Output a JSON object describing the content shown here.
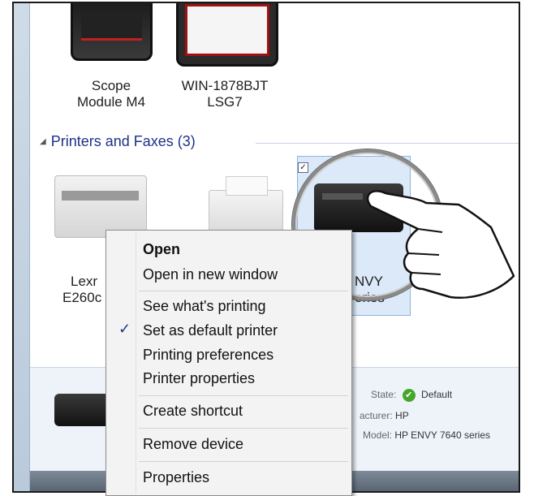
{
  "devices_top": [
    {
      "line1": "Scope",
      "line2": "Module M4"
    },
    {
      "line1": "WIN-1878BJT",
      "line2": "LSG7"
    }
  ],
  "group": {
    "label": "Printers and Faxes (3)"
  },
  "printers": [
    {
      "label_fragment_1": "Lexr",
      "label_fragment_2": "E260c"
    },
    {
      "label_fragment_1": "NVY",
      "label_fragment_2": "eries"
    }
  ],
  "selected_checkbox": "✓",
  "menu": {
    "items": [
      {
        "label": "Open"
      },
      {
        "label": "Open in new window"
      },
      {
        "label": "See what's printing"
      },
      {
        "label": "Set as default printer",
        "checked": "✓"
      },
      {
        "label": "Printing preferences"
      },
      {
        "label": "Printer properties"
      },
      {
        "label": "Create shortcut"
      },
      {
        "label": "Remove device"
      },
      {
        "label": "Properties"
      }
    ]
  },
  "details": {
    "state_label": "State:",
    "state_value": "Default",
    "manufacturer_label": "acturer:",
    "manufacturer_value": "HP",
    "model_label": "Model:",
    "model_value": "HP ENVY 7640 series"
  },
  "colors": {
    "header_blue": "#1e3287",
    "selection": "#dbe9f8",
    "ok_green": "#46a62a"
  }
}
